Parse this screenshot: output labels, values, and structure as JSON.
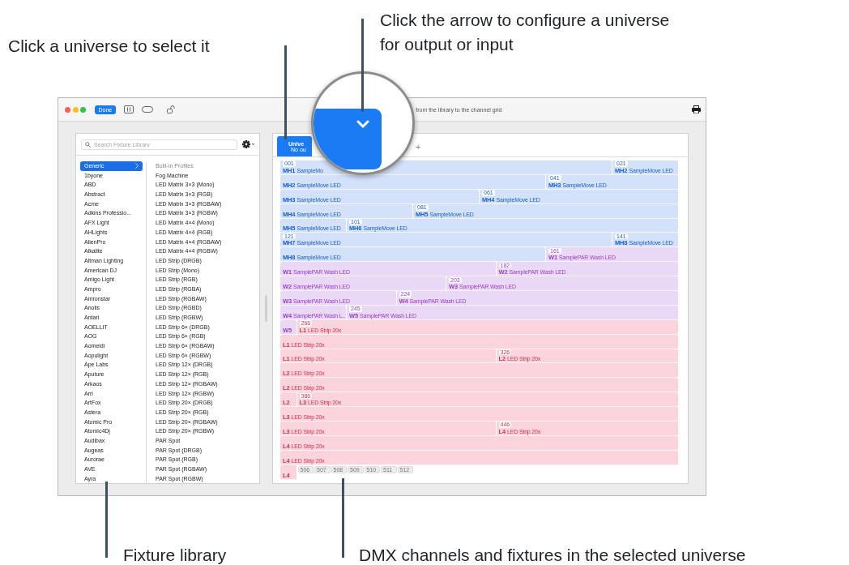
{
  "callouts": {
    "select_universe": "Click a universe to select it",
    "configure_universe": "Click the arrow to configure a universe for output or input",
    "fixture_library": "Fixture library",
    "dmx_channels": "DMX channels and fixtures in the selected universe"
  },
  "toolbar": {
    "done_button": "Done",
    "hint": "from the library to the channel grid"
  },
  "library": {
    "search_placeholder": "Search Fixture Library",
    "profiles_header": "Built-in Profiles",
    "manufacturers": [
      {
        "label": "Generic",
        "selected": true
      },
      {
        "label": "1byone",
        "selected": false
      },
      {
        "label": "ABD",
        "selected": false
      },
      {
        "label": "Abstract",
        "selected": false
      },
      {
        "label": "Acme",
        "selected": false
      },
      {
        "label": "Adkins Professio...",
        "selected": false
      },
      {
        "label": "AFX Light",
        "selected": false
      },
      {
        "label": "AHLights",
        "selected": false
      },
      {
        "label": "AlienPro",
        "selected": false
      },
      {
        "label": "Alkalite",
        "selected": false
      },
      {
        "label": "Altman Lighting",
        "selected": false
      },
      {
        "label": "American DJ",
        "selected": false
      },
      {
        "label": "Amigo Light",
        "selected": false
      },
      {
        "label": "Ampro",
        "selected": false
      },
      {
        "label": "Amronstar",
        "selected": false
      },
      {
        "label": "Anolis",
        "selected": false
      },
      {
        "label": "Antari",
        "selected": false
      },
      {
        "label": "AOELLIT",
        "selected": false
      },
      {
        "label": "AOG",
        "selected": false
      },
      {
        "label": "Aomeidi",
        "selected": false
      },
      {
        "label": "Aopulight",
        "selected": false
      },
      {
        "label": "Ape Labs",
        "selected": false
      },
      {
        "label": "Aputure",
        "selected": false
      },
      {
        "label": "Arkaos",
        "selected": false
      },
      {
        "label": "Arri",
        "selected": false
      },
      {
        "label": "ArtFox",
        "selected": false
      },
      {
        "label": "Astera",
        "selected": false
      },
      {
        "label": "Atomic Pro",
        "selected": false
      },
      {
        "label": "Atomic4Dj",
        "selected": false
      },
      {
        "label": "Audibax",
        "selected": false
      },
      {
        "label": "Augeas",
        "selected": false
      },
      {
        "label": "Aurorae",
        "selected": false
      },
      {
        "label": "AVE",
        "selected": false
      },
      {
        "label": "Ayra",
        "selected": false
      }
    ],
    "profiles": [
      "Fog Machine",
      "LED Matrix 3×3 (Mono)",
      "LED Matrix 3×3 (RGB)",
      "LED Matrix 3×3 (RGBAW)",
      "LED Matrix 3×3 (RGBW)",
      "LED Matrix 4×4 (Mono)",
      "LED Matrix 4×4 (RGB)",
      "LED Matrix 4×4 (RGBAW)",
      "LED Matrix 4×4 (RGBW)",
      "LED Strip (DRGB)",
      "LED Strip (Mono)",
      "LED Strip (RGB)",
      "LED Strip (RGBA)",
      "LED Strip (RGBAW)",
      "LED Strip (RGBD)",
      "LED Strip (RGBW)",
      "LED Strip 6× (DRGB)",
      "LED Strip 6× (RGB)",
      "LED Strip 6× (RGBAW)",
      "LED Strip 6× (RGBW)",
      "LED Strip 12× (DRGB)",
      "LED Strip 12× (RGB)",
      "LED Strip 12× (RGBAW)",
      "LED Strip 12× (RGBW)",
      "LED Strip 20× (DRGB)",
      "LED Strip 20× (RGB)",
      "LED Strip 20× (RGBAW)",
      "LED Strip 20× (RGBW)",
      "PAR Spot",
      "PAR Spot (DRGB)",
      "PAR Spot (RGB)",
      "PAR Spot (RGBAW)",
      "PAR Spot (RGBW)"
    ]
  },
  "universe_tabs": [
    {
      "title": "Unive",
      "subtitle": "No ou",
      "selected": true
    }
  ],
  "add_universe_button": "+",
  "channel_grid": {
    "rows": [
      {
        "segments": [
          {
            "kind": "moving-head",
            "address": "001",
            "name": "MH1",
            "model": "SampleMo"
          },
          {
            "kind": "moving-head",
            "address": "021",
            "name": "MH2",
            "model": "SampleMove LED"
          }
        ]
      },
      {
        "segments": [
          {
            "kind": "moving-head",
            "name": "MH2",
            "model": "SampleMove LED"
          },
          {
            "kind": "moving-head",
            "address": "041",
            "name": "MH3",
            "model": "SampleMove LED"
          }
        ]
      },
      {
        "segments": [
          {
            "kind": "moving-head",
            "name": "MH3",
            "model": "SampleMove LED"
          },
          {
            "kind": "moving-head",
            "address": "061",
            "name": "MH4",
            "model": "SampleMove LED"
          }
        ]
      },
      {
        "segments": [
          {
            "kind": "moving-head",
            "name": "MH4",
            "model": "SampleMove LED"
          },
          {
            "kind": "moving-head",
            "address": "081",
            "name": "MH5",
            "model": "SampleMove LED"
          }
        ]
      },
      {
        "segments": [
          {
            "kind": "moving-head",
            "name": "MH5",
            "model": "SampleMove LED"
          },
          {
            "kind": "moving-head",
            "address": "101",
            "name": "MH6",
            "model": "SampleMove LED"
          }
        ]
      },
      {
        "segments": [
          {
            "kind": "moving-head",
            "address": "121",
            "name": "MH7",
            "model": "SampleMove LED"
          },
          {
            "kind": "moving-head",
            "address": "141",
            "name": "MH8",
            "model": "SampleMove LED"
          }
        ]
      },
      {
        "segments": [
          {
            "kind": "moving-head",
            "name": "MH8",
            "model": "SampleMove LED"
          },
          {
            "kind": "wash",
            "address": "161",
            "name": "W1",
            "model": "SamplePAR Wash LED"
          }
        ]
      },
      {
        "segments": [
          {
            "kind": "wash",
            "name": "W1",
            "model": "SamplePAR Wash LED"
          },
          {
            "kind": "wash",
            "address": "182",
            "name": "W2",
            "model": "SamplePAR Wash LED"
          }
        ]
      },
      {
        "segments": [
          {
            "kind": "wash",
            "name": "W2",
            "model": "SamplePAR Wash LED"
          },
          {
            "kind": "wash",
            "address": "203",
            "name": "W3",
            "model": "SamplePAR Wash LED"
          }
        ]
      },
      {
        "segments": [
          {
            "kind": "wash",
            "name": "W3",
            "model": "SamplePAR Wash LED"
          },
          {
            "kind": "wash",
            "address": "224",
            "name": "W4",
            "model": "SamplePAR Wash LED"
          }
        ]
      },
      {
        "segments": [
          {
            "kind": "wash",
            "name": "W4",
            "model": "SamplePAR Wash L..."
          },
          {
            "kind": "wash",
            "address": "245",
            "name": "W5",
            "model": "SamplePAR Wash LED"
          }
        ]
      },
      {
        "segments": [
          {
            "kind": "wash",
            "name": "W5"
          },
          {
            "kind": "strip",
            "address": "266",
            "name": "L1",
            "model": "LED Strip 20x"
          }
        ]
      },
      {
        "segments": [
          {
            "kind": "strip",
            "name": "L1",
            "model": "LED Strip 20x"
          }
        ]
      },
      {
        "segments": [
          {
            "kind": "strip",
            "name": "L1",
            "model": "LED Strip 20x"
          },
          {
            "kind": "strip",
            "address": "326",
            "name": "L2",
            "model": "LED Strip 20x"
          }
        ]
      },
      {
        "segments": [
          {
            "kind": "strip",
            "name": "L2",
            "model": "LED Strip 20x"
          }
        ]
      },
      {
        "segments": [
          {
            "kind": "strip",
            "name": "L2",
            "model": "LED Strip 20x"
          }
        ]
      },
      {
        "segments": [
          {
            "kind": "strip",
            "name": "L2"
          },
          {
            "kind": "strip",
            "address": "386",
            "name": "L3",
            "model": "LED Strip 20x"
          }
        ]
      },
      {
        "segments": [
          {
            "kind": "strip",
            "name": "L3",
            "model": "LED Strip 20x"
          }
        ]
      },
      {
        "segments": [
          {
            "kind": "strip",
            "name": "L3",
            "model": "LED Strip 20x"
          },
          {
            "kind": "strip",
            "address": "446",
            "name": "L4",
            "model": "LED Strip 20x"
          }
        ]
      },
      {
        "segments": [
          {
            "kind": "strip",
            "name": "L4",
            "model": "LED Strip 20x"
          }
        ]
      },
      {
        "segments": [
          {
            "kind": "strip",
            "name": "L4",
            "model": "LED Strip 20x"
          }
        ]
      },
      {
        "segments": [
          {
            "kind": "strip",
            "name": "L4"
          },
          {
            "kind": "empty",
            "address": "506"
          },
          {
            "kind": "empty",
            "address": "507"
          },
          {
            "kind": "empty",
            "address": "508"
          },
          {
            "kind": "empty",
            "address": "509"
          },
          {
            "kind": "empty",
            "address": "510"
          },
          {
            "kind": "empty",
            "address": "511"
          },
          {
            "kind": "empty",
            "address": "512"
          }
        ]
      }
    ]
  }
}
